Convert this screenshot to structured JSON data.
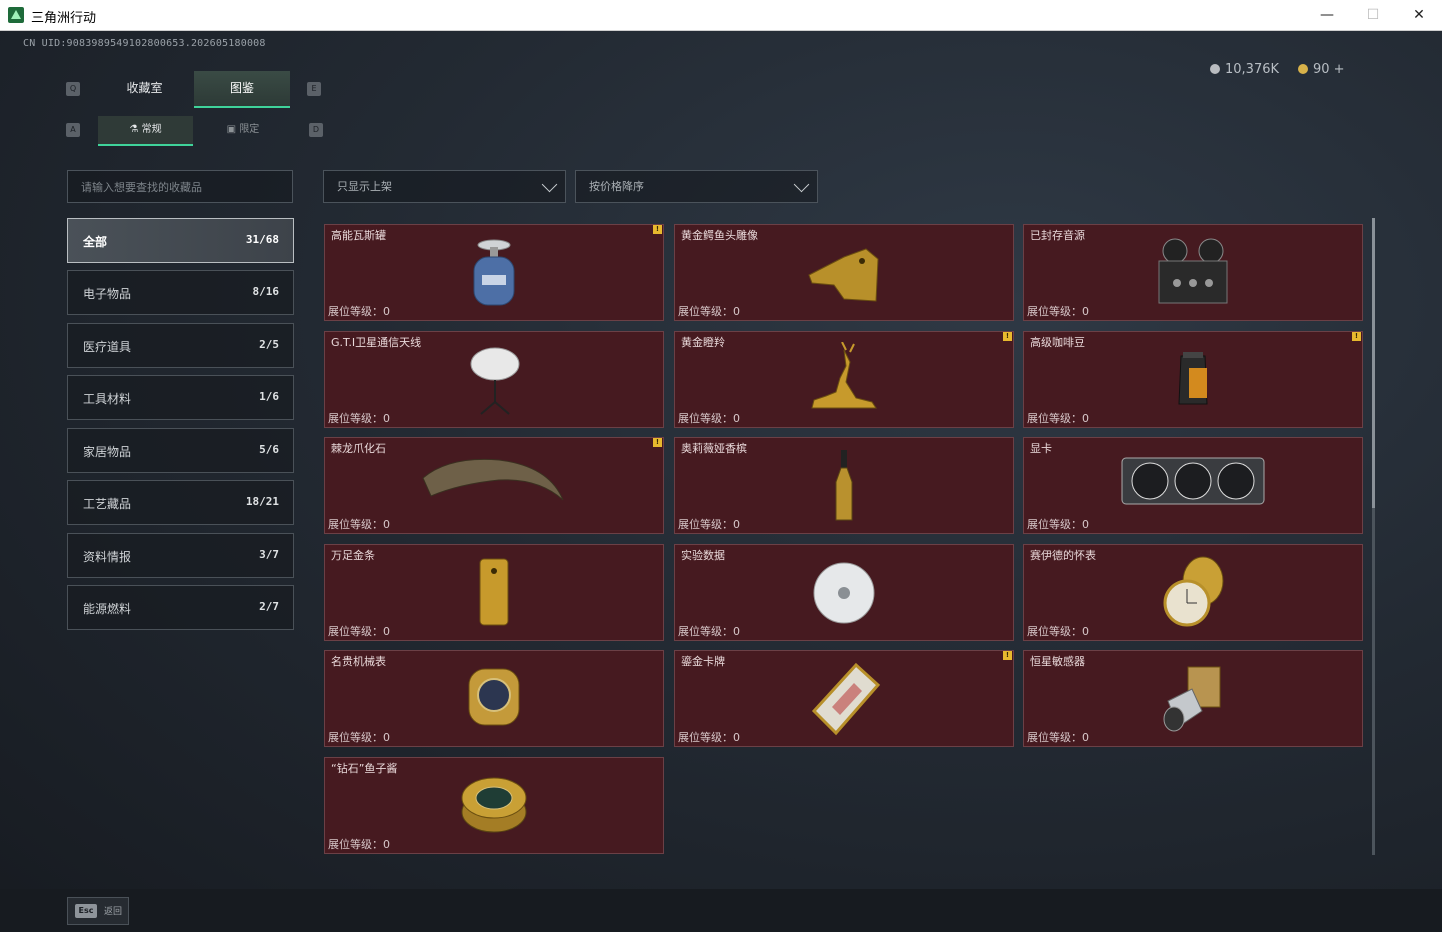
{
  "window": {
    "title": "三角洲行动",
    "minimize": "—",
    "maximize": "☐",
    "close": "✕"
  },
  "header": {
    "uid": "CN UID:9083989549102800653.202605180008",
    "currency": [
      {
        "value": "10,376K",
        "color": "#b9bcc0"
      },
      {
        "value": "90 +",
        "color": "#d8b24a"
      }
    ]
  },
  "key_hints": {
    "tab_left": "Q",
    "tab_right": "E",
    "sub_left": "A",
    "sub_right": "D"
  },
  "tabs": [
    {
      "label": "收藏室",
      "active": false
    },
    {
      "label": "图鉴",
      "active": true
    }
  ],
  "subtabs": [
    {
      "label": "常规",
      "icon": "flask-icon",
      "active": true
    },
    {
      "label": "限定",
      "icon": "image-icon",
      "active": false
    }
  ],
  "search": {
    "placeholder": "请输入想要查找的收藏品",
    "value": ""
  },
  "filters": [
    {
      "label": "只显示上架"
    },
    {
      "label": "按价格降序"
    }
  ],
  "categories": [
    {
      "name": "全部",
      "count": "31/68",
      "active": true
    },
    {
      "name": "电子物品",
      "count": "8/16",
      "active": false
    },
    {
      "name": "医疗道具",
      "count": "2/5",
      "active": false
    },
    {
      "name": "工具材料",
      "count": "1/6",
      "active": false
    },
    {
      "name": "家居物品",
      "count": "5/6",
      "active": false
    },
    {
      "name": "工艺藏品",
      "count": "18/21",
      "active": false
    },
    {
      "name": "资料情报",
      "count": "3/7",
      "active": false
    },
    {
      "name": "能源燃料",
      "count": "2/7",
      "active": false
    }
  ],
  "level_label": "展位等级：",
  "items": [
    {
      "name": "高能瓦斯罐",
      "level": "0",
      "badge": "!",
      "icon": "gas-canister-icon"
    },
    {
      "name": "黄金鳄鱼头雕像",
      "level": "0",
      "badge": "",
      "icon": "gold-crocodile-head-icon"
    },
    {
      "name": "已封存音源",
      "level": "0",
      "badge": "",
      "icon": "reel-recorder-icon"
    },
    {
      "name": "G.T.I卫星通信天线",
      "level": "0",
      "badge": "",
      "icon": "satellite-dish-icon"
    },
    {
      "name": "黄金瞪羚",
      "level": "0",
      "badge": "!",
      "icon": "gold-gazelle-icon"
    },
    {
      "name": "高级咖啡豆",
      "level": "0",
      "badge": "!",
      "icon": "coffee-bag-icon"
    },
    {
      "name": "棘龙爪化石",
      "level": "0",
      "badge": "!",
      "icon": "claw-fossil-icon"
    },
    {
      "name": "奥莉薇娅香槟",
      "level": "0",
      "badge": "",
      "icon": "champagne-icon"
    },
    {
      "name": "显卡",
      "level": "0",
      "badge": "",
      "icon": "graphics-card-icon"
    },
    {
      "name": "万足金条",
      "level": "0",
      "badge": "",
      "icon": "gold-bar-icon"
    },
    {
      "name": "实验数据",
      "level": "0",
      "badge": "",
      "icon": "disc-icon"
    },
    {
      "name": "赛伊德的怀表",
      "level": "0",
      "badge": "",
      "icon": "pocket-watch-icon"
    },
    {
      "name": "名贵机械表",
      "level": "0",
      "badge": "",
      "icon": "wristwatch-icon"
    },
    {
      "name": "鎏金卡牌",
      "level": "0",
      "badge": "!",
      "icon": "gilded-card-icon"
    },
    {
      "name": "恒星敏感器",
      "level": "0",
      "badge": "",
      "icon": "star-sensor-icon"
    },
    {
      "name": "“钻石”鱼子酱",
      "level": "0",
      "badge": "",
      "icon": "caviar-tin-icon"
    }
  ],
  "footer": {
    "esc_key": "Esc",
    "esc_label": "返回"
  }
}
